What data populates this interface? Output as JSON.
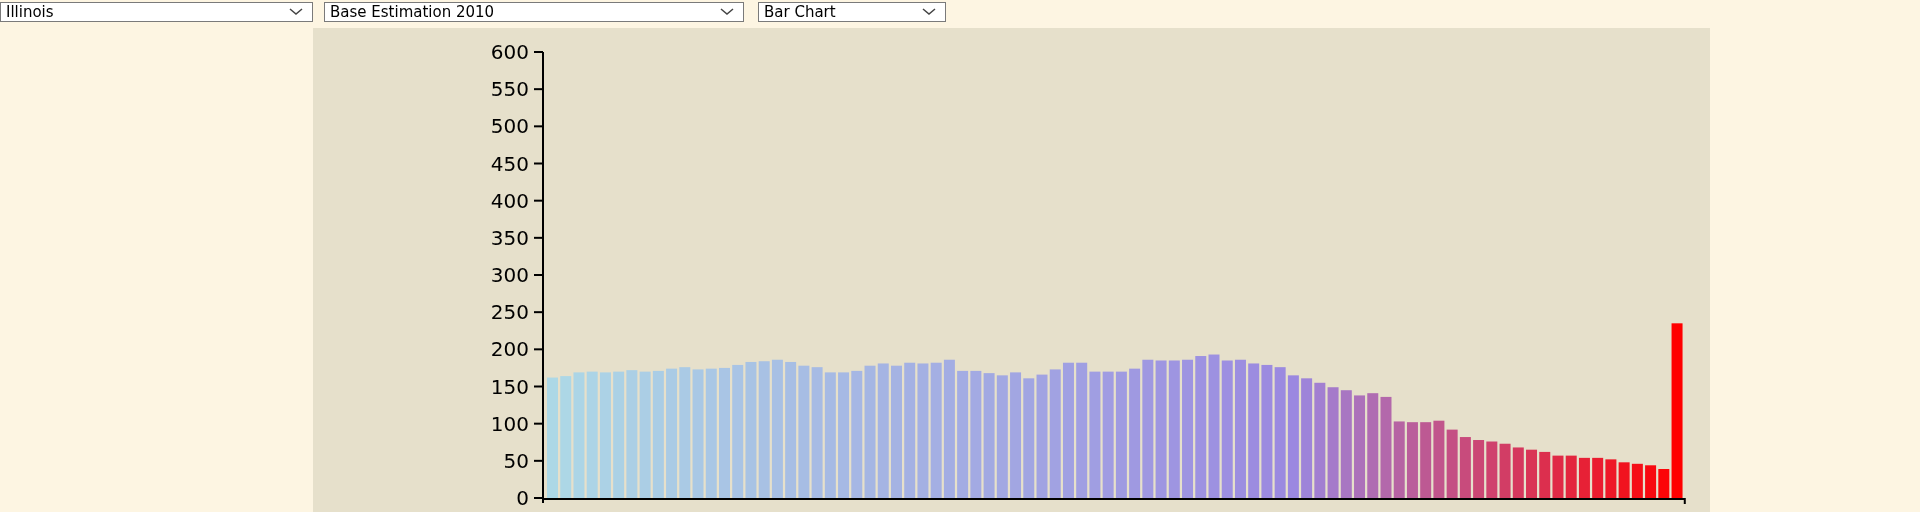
{
  "controls": [
    {
      "kind": "dropdown",
      "value": "Illinois"
    },
    {
      "kind": "dropdown",
      "value": "Base Estimation 2010"
    },
    {
      "kind": "dropdown",
      "value": "Bar Chart"
    }
  ],
  "chart": {
    "chart_data": {
      "type": "bar",
      "ylim": [
        0,
        600
      ],
      "yticks": [
        0,
        50,
        100,
        150,
        200,
        250,
        300,
        350,
        400,
        450,
        500,
        550,
        600
      ],
      "series": [
        {
          "values": [
            162,
            164,
            169,
            170,
            169,
            170,
            172,
            170,
            171,
            174,
            176,
            173,
            174,
            175,
            179,
            183,
            184,
            186,
            183,
            178,
            176,
            169,
            169,
            171,
            178,
            181,
            178,
            182,
            181,
            182,
            186,
            171,
            171,
            168,
            165,
            169,
            161,
            166,
            173,
            182,
            182,
            170,
            170,
            170,
            174,
            186,
            185,
            185,
            186,
            191,
            193,
            185,
            186,
            181,
            179,
            176,
            165,
            161,
            155,
            149,
            145,
            138,
            141,
            136,
            103,
            102,
            102,
            104,
            92,
            82,
            78,
            76,
            73,
            68,
            65,
            62,
            57,
            57,
            54,
            54,
            52,
            48,
            46,
            44,
            39,
            235
          ]
        }
      ]
    }
  }
}
